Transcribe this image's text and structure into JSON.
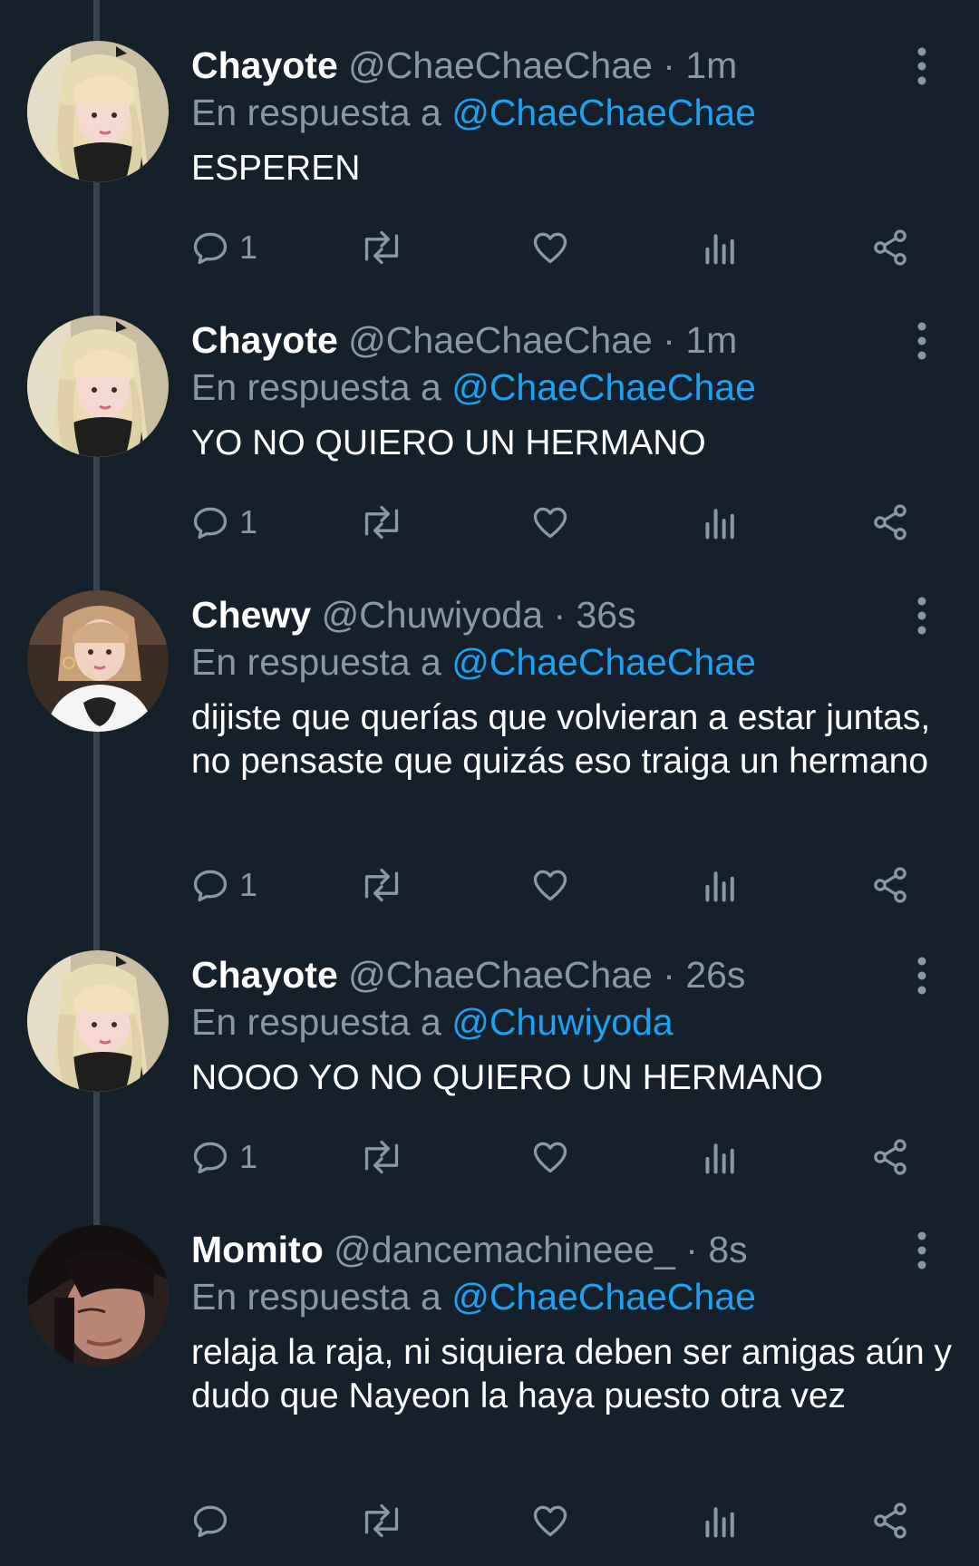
{
  "colors": {
    "background": "#15202b",
    "secondary_text": "#8899a6",
    "link": "#1da1f2",
    "thread_line": "#38444d"
  },
  "icons": {
    "reply": "comment-bubble-icon",
    "retweet": "retweet-arrows-icon",
    "like": "heart-icon",
    "analytics": "bar-chart-icon",
    "share": "share-icon",
    "more": "vertical-ellipsis-icon"
  },
  "reply_prefix": "En respuesta a",
  "dot": "·",
  "tweets": [
    {
      "name": "Chayote",
      "handle": "@ChaeChaeChae",
      "time": "1m",
      "reply_to": "@ChaeChaeChae",
      "text": "ESPEREN",
      "reply_count": "1"
    },
    {
      "name": "Chayote",
      "handle": "@ChaeChaeChae",
      "time": "1m",
      "reply_to": "@ChaeChaeChae",
      "text": "YO NO QUIERO UN HERMANO",
      "reply_count": "1"
    },
    {
      "name": "Chewy",
      "handle": "@Chuwiyoda",
      "time": "36s",
      "reply_to": "@ChaeChaeChae",
      "text": "dijiste que querías que volvieran a estar juntas, no pensaste que quizás eso traiga un hermano",
      "reply_count": "1"
    },
    {
      "name": "Chayote",
      "handle": "@ChaeChaeChae",
      "time": "26s",
      "reply_to": "@Chuwiyoda",
      "text": "NOOO YO NO QUIERO UN HERMANO",
      "reply_count": "1"
    },
    {
      "name": "Momito",
      "handle": "@dancemachineee_",
      "time": "8s",
      "reply_to": "@ChaeChaeChae",
      "text": "relaja la raja, ni siquiera deben ser amigas aún y dudo que Nayeon la haya puesto otra vez",
      "reply_count": ""
    }
  ]
}
